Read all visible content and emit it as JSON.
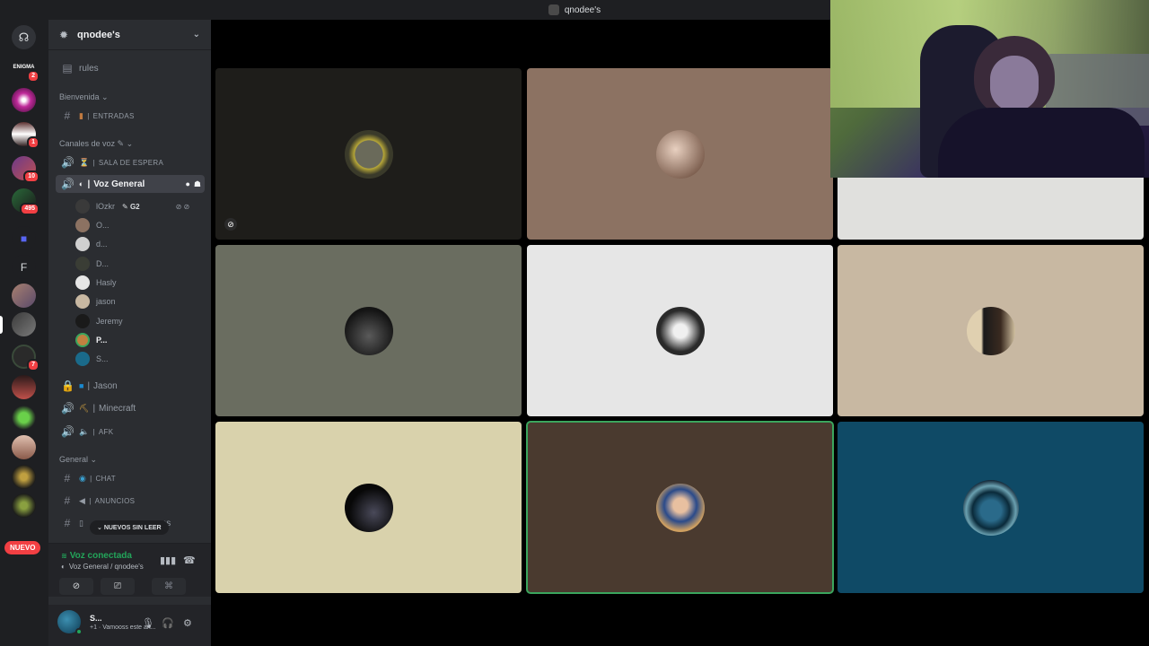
{
  "window": {
    "title": "qnodee's"
  },
  "rail": {
    "badges": [
      "2",
      "1",
      "10",
      "495",
      "7"
    ],
    "enigma_label": "ENIGMA",
    "folder_letter": "F",
    "new_label": "NUEVO"
  },
  "guild": {
    "name": "qnodee's"
  },
  "channels": {
    "rules": "rules",
    "cat_bienvenida": "Bienvenida",
    "entradas": "ENTRADAS",
    "cat_voz": "Canales de voz",
    "sala_espera": "SALA DE ESPERA",
    "voz_general": "Voz General",
    "jason": "Jason",
    "minecraft": "Minecraft",
    "afk": "AFK",
    "cat_general": "General",
    "chat": "CHAT",
    "anuncios": "ANUNCIOS",
    "partial": "ms",
    "new_unread": "NUEVOS SIN LEER"
  },
  "voice_users": [
    {
      "name": "lOzkr",
      "tag": "G2"
    },
    {
      "name": "O..."
    },
    {
      "name": "d..."
    },
    {
      "name": "D..."
    },
    {
      "name": "Hasly"
    },
    {
      "name": "jason"
    },
    {
      "name": "Jeremy"
    },
    {
      "name": "P..."
    },
    {
      "name": "S..."
    }
  ],
  "voice_panel": {
    "status": "Voz conectada",
    "location": "Voz General / qnodee's"
  },
  "user_panel": {
    "name": "S...",
    "status": "+1 · Vamooss este añ..."
  },
  "colors": {
    "rail_bg": "#1e1f22",
    "sidebar_bg": "#2b2d31",
    "connected_green": "#23a55a",
    "speaking_outline": "#3ba55d",
    "badge_red": "#f23f43"
  },
  "tiles": [
    {
      "bg": "#1e1d1a",
      "icon": "avatar-person-yellow-ring",
      "muted": true
    },
    {
      "bg": "#8c7262",
      "icon": "avatar-face"
    },
    {
      "bg": "#e0e0dd",
      "icon": "avatar-hidden"
    },
    {
      "bg": "#6a6d60",
      "icon": "avatar-dark-hair"
    },
    {
      "bg": "#e6e6e6",
      "icon": "avatar-bw-person"
    },
    {
      "bg": "#c8b8a2",
      "icon": "avatar-doorway"
    },
    {
      "bg": "#d9d2ac",
      "icon": "avatar-black"
    },
    {
      "bg": "#4a3a2f",
      "icon": "avatar-blue-uniform",
      "speaking": true
    },
    {
      "bg": "#0f4a66",
      "icon": "avatar-dome-city"
    }
  ]
}
